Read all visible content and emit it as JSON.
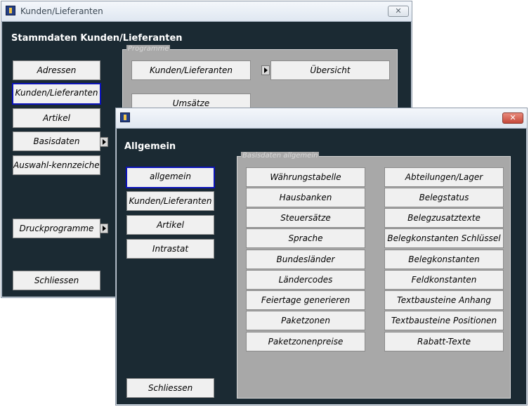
{
  "win1": {
    "title": "Kunden/Lieferanten",
    "close": "✕",
    "header": "Stammdaten Kunden/Lieferanten",
    "menu": [
      "Adressen",
      "Kunden/Lieferanten",
      "Artikel",
      "Basisdaten",
      "Auswahl-kennzeichen",
      "Druckprogramme",
      "Schliessen"
    ],
    "group_label": "Programme",
    "programs": [
      "Kunden/Lieferanten",
      "Übersicht",
      "Umsätze"
    ]
  },
  "win2": {
    "title": "",
    "close": "✕",
    "header": "Allgemein",
    "menu": [
      "allgemein",
      "Kunden/Lieferanten",
      "Artikel",
      "Intrastat"
    ],
    "close_label": "Schliessen",
    "group_label": "Basisdaten allgemein",
    "left_col": [
      "Währungstabelle",
      "Hausbanken",
      "Steuersätze",
      "Sprache",
      "Bundesländer",
      "Ländercodes",
      "Feiertage generieren",
      "Paketzonen",
      "Paketzonenpreise"
    ],
    "right_col": [
      "Abteilungen/Lager",
      "Belegstatus",
      "Belegzusatztexte",
      "Belegkonstanten Schlüssel",
      "Belegkonstanten",
      "Feldkonstanten",
      "Textbausteine Anhang",
      "Textbausteine Positionen",
      "Rabatt-Texte"
    ]
  },
  "colors": {
    "window_bg": "#1b2a33",
    "group_bg": "#a8a8a8",
    "button_bg": "#f0f0f0",
    "selection_border": "#0b12b9"
  }
}
